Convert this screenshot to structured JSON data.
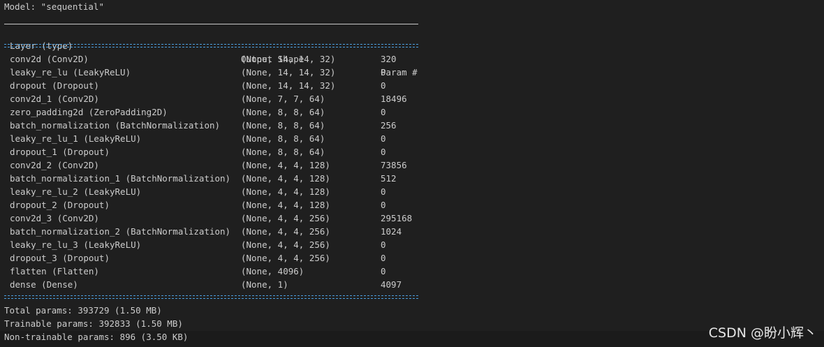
{
  "model_line": "Model: \"sequential\"",
  "header": {
    "layer": "Layer (type)",
    "shape": "Output Shape",
    "param": "Param #"
  },
  "layers": [
    {
      "name": "conv2d (Conv2D)",
      "shape": "(None, 14, 14, 32)",
      "param": "320"
    },
    {
      "name": "leaky_re_lu (LeakyReLU)",
      "shape": "(None, 14, 14, 32)",
      "param": "0"
    },
    {
      "name": "dropout (Dropout)",
      "shape": "(None, 14, 14, 32)",
      "param": "0"
    },
    {
      "name": "conv2d_1 (Conv2D)",
      "shape": "(None, 7, 7, 64)",
      "param": "18496"
    },
    {
      "name": "zero_padding2d (ZeroPadding2D)",
      "shape": "(None, 8, 8, 64)",
      "param": "0"
    },
    {
      "name": "batch_normalization (BatchNormalization)",
      "shape": "(None, 8, 8, 64)",
      "param": "256"
    },
    {
      "name": "leaky_re_lu_1 (LeakyReLU)",
      "shape": "(None, 8, 8, 64)",
      "param": "0"
    },
    {
      "name": "dropout_1 (Dropout)",
      "shape": "(None, 8, 8, 64)",
      "param": "0"
    },
    {
      "name": "conv2d_2 (Conv2D)",
      "shape": "(None, 4, 4, 128)",
      "param": "73856"
    },
    {
      "name": "batch_normalization_1 (BatchNormalization)",
      "shape": "(None, 4, 4, 128)",
      "param": "512"
    },
    {
      "name": "leaky_re_lu_2 (LeakyReLU)",
      "shape": "(None, 4, 4, 128)",
      "param": "0"
    },
    {
      "name": "dropout_2 (Dropout)",
      "shape": "(None, 4, 4, 128)",
      "param": "0"
    },
    {
      "name": "conv2d_3 (Conv2D)",
      "shape": "(None, 4, 4, 256)",
      "param": "295168"
    },
    {
      "name": "batch_normalization_2 (BatchNormalization)",
      "shape": "(None, 4, 4, 256)",
      "param": "1024"
    },
    {
      "name": "leaky_re_lu_3 (LeakyReLU)",
      "shape": "(None, 4, 4, 256)",
      "param": "0"
    },
    {
      "name": "dropout_3 (Dropout)",
      "shape": "(None, 4, 4, 256)",
      "param": "0"
    },
    {
      "name": "flatten (Flatten)",
      "shape": "(None, 4096)",
      "param": "0"
    },
    {
      "name": "dense (Dense)",
      "shape": "(None, 1)",
      "param": "4097"
    }
  ],
  "summary": {
    "total": "Total params: 393729 (1.50 MB)",
    "trainable": "Trainable params: 392833 (1.50 MB)",
    "non_trainable": "Non-trainable params: 896 (3.50 KB)"
  },
  "watermark": "CSDN @盼小辉丶"
}
